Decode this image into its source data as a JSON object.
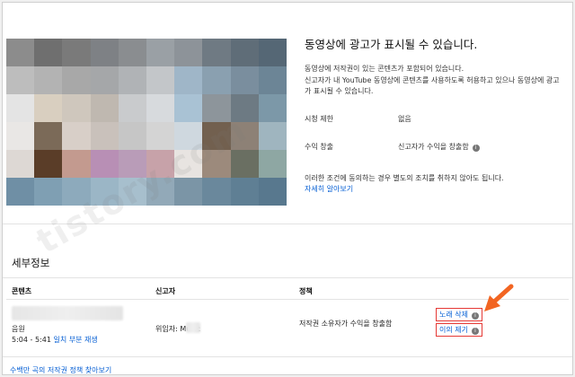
{
  "claim_info": {
    "title": "동영상에 광고가 표시될 수 있습니다.",
    "desc_line1": "동영상에 저작권이 있는 콘텐츠가 포함되어 있습니다.",
    "desc_line2": "신고자가 내 YouTube 동영상에 콘텐츠를 사용하도록 허용하고 있으나 동영상에 광고가 표시될 수 있습니다.",
    "rows": [
      {
        "key": "시청 제한",
        "value": "없음"
      },
      {
        "key": "수익 창출",
        "value": "신고자가 수익을 창출함"
      }
    ],
    "note": "이러한 조건에 동의하는 경우 별도의 조치를 취하지 않아도 됩니다.",
    "learn_more": "자세히 알아보기"
  },
  "details": {
    "title": "세부정보",
    "columns": [
      "콘텐츠",
      "신고자",
      "정책"
    ],
    "row": {
      "content_type": "음원",
      "time_range": "5:04 - 5:41",
      "play_link": "일치 부분 재생",
      "claimant": "위임자: Music",
      "policy": "저작권 소유자가 수익을 창출함",
      "actions": [
        "노래 삭제",
        "이의 제기"
      ]
    }
  },
  "footer_link": "수백만 곡의 저작권 정책 찾아보기",
  "watermark": "tistory.com",
  "colors": {
    "link": "#065fd4",
    "highlight": "#e53935",
    "arrow": "#f26522"
  },
  "icons": [
    "info-icon",
    "arrow-icon"
  ]
}
